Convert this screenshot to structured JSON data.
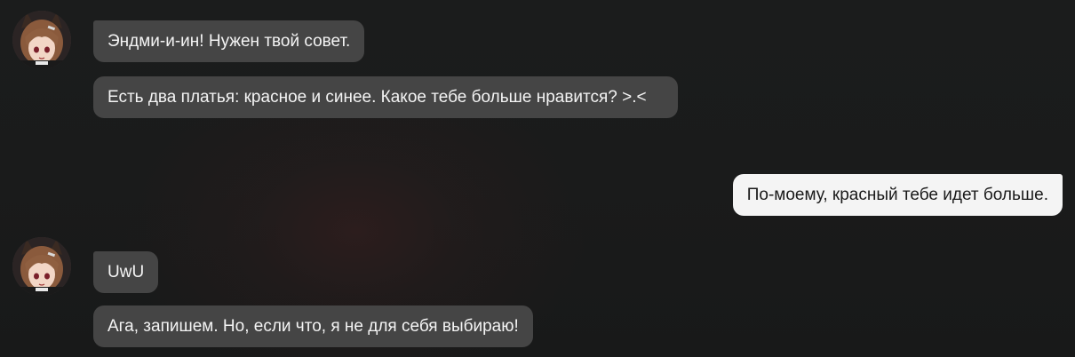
{
  "chat": {
    "messages": [
      {
        "sender": "character",
        "text": "Эндми-и-ин! Нужен твой совет."
      },
      {
        "sender": "character",
        "text": "Есть два платья: красное и синее. Какое тебе больше нравится? >.<"
      },
      {
        "sender": "user",
        "text": "По-моему, красный тебе идет больше."
      },
      {
        "sender": "character",
        "text": "UwU"
      },
      {
        "sender": "character",
        "text": "Ага, запишем. Но, если что, я не для себя выбираю!"
      }
    ]
  },
  "colors": {
    "background": "#1b1c1c",
    "incoming_bubble": "#454545",
    "outgoing_bubble": "#f4f4f4",
    "hair": "#8a5a3c"
  },
  "icons": {
    "avatar": "character-avatar-icon"
  }
}
